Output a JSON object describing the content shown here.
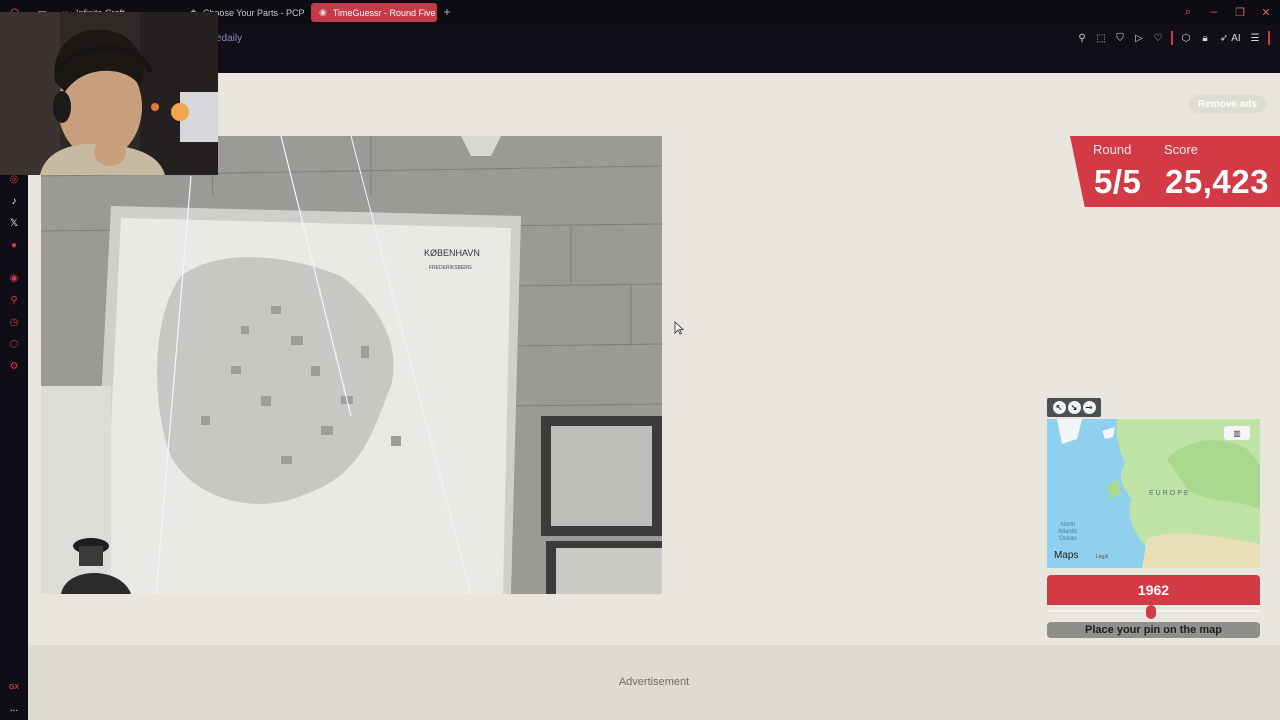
{
  "browser": {
    "tabs": [
      {
        "label": "Infinite Craft",
        "icon": "infinity-icon",
        "active": false
      },
      {
        "label": "Choose Your Parts - PCPa",
        "icon": "pcpartpicker-icon",
        "active": false
      },
      {
        "label": "TimeGuessr - Round Five",
        "icon": "timeguessr-icon",
        "active": true
      }
    ],
    "new_tab": "+",
    "url_fragment": "edaily",
    "ai_label": "AI"
  },
  "sidebar": {
    "bottom_label": "GX",
    "more": "..."
  },
  "game": {
    "remove_ads": "Remove ads",
    "round_label": "Round",
    "round_value": "5/5",
    "score_label": "Score",
    "score_value": "25,423",
    "year_value": "1962",
    "year_slider_fraction": 0.49,
    "place_pin": "Place your pin on the map",
    "photo_map_title": "KØBENHAVN",
    "photo_map_subtitle": "FREDERIKSBERG"
  },
  "minimap": {
    "region_label": "EUROPE",
    "ocean_label": "North Atlantic Ocean",
    "brand": "Maps",
    "legal": "Legal"
  },
  "ad": {
    "label": "Advertisement"
  },
  "colors": {
    "accent": "#d23a46",
    "page_bg": "#e8e6dd",
    "browser_bg": "#0d0c13"
  }
}
